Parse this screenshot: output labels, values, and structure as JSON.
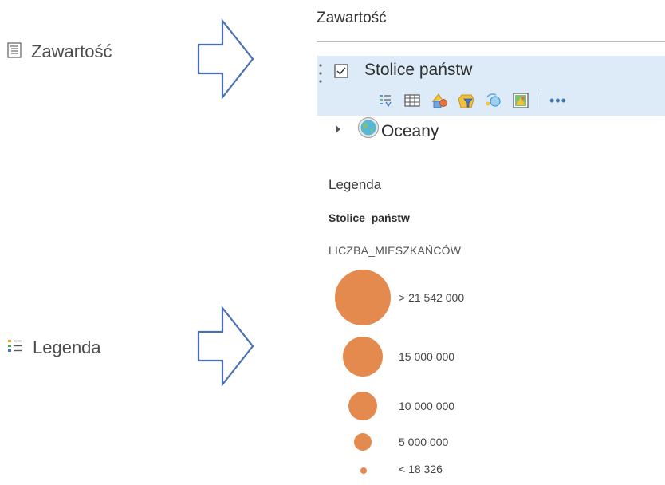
{
  "left_panel": {
    "contents_button": {
      "label": "Zawartość",
      "icon": "contents-list-icon"
    },
    "legend_button": {
      "label": "Legenda",
      "icon": "legend-list-icon"
    }
  },
  "contents_panel": {
    "title": "Zawartość",
    "layers": [
      {
        "name": "Stolice państw",
        "checked": true,
        "selected": true
      },
      {
        "name": "Oceany",
        "expanded": false
      }
    ],
    "toolbar": {
      "tools": [
        "show-table-of-contents-icon",
        "attribute-table-icon",
        "change-style-icon",
        "filter-icon",
        "perform-analysis-icon",
        "configure-popup-icon"
      ],
      "more_label": "•••"
    },
    "selection_color": "#dcebf7"
  },
  "legend_panel": {
    "heading": "Legenda",
    "layer_name": "Stolice_państw",
    "field_name": "LICZBA_MIESZKAŃCÓW",
    "symbol_color": "#e48a4e",
    "classes": [
      {
        "label": "> 21 542 000"
      },
      {
        "label": "15 000 000"
      },
      {
        "label": "10 000 000"
      },
      {
        "label": "5 000 000"
      },
      {
        "label": "< 18 326"
      }
    ]
  },
  "colors": {
    "arrow_stroke": "#4a6fb5"
  }
}
